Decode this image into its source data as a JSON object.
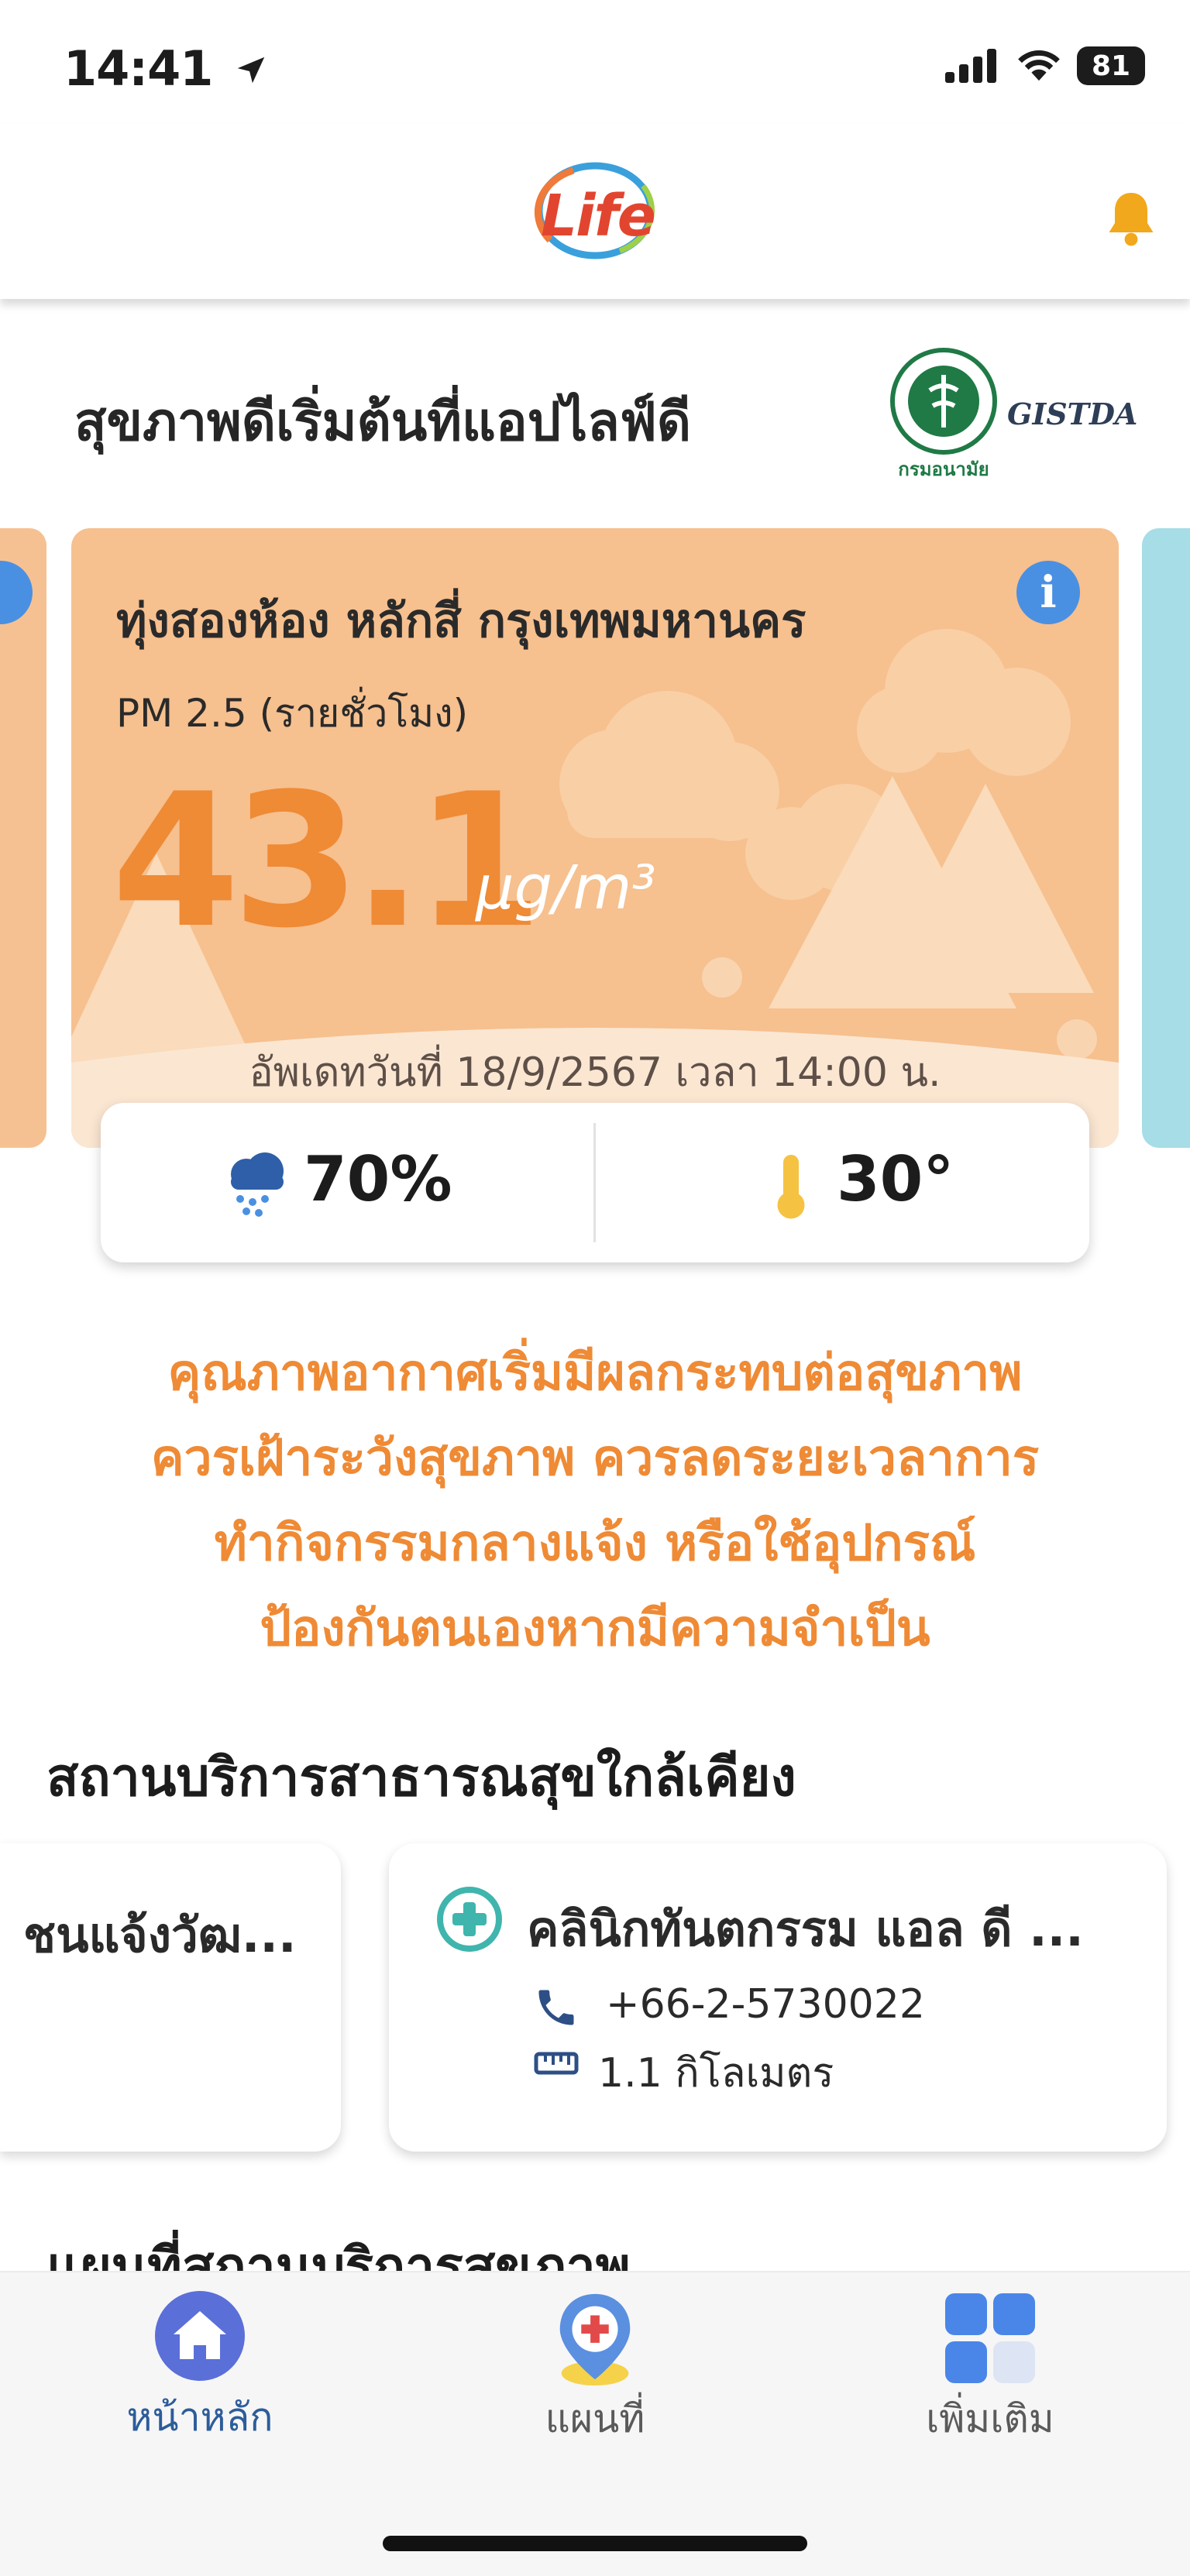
{
  "status": {
    "time": "14:41",
    "battery": "81"
  },
  "header": {
    "logo_text": "Life"
  },
  "intro": {
    "title": "สุขภาพดีเริ่มต้นที่แอปไลฟ์ดี",
    "partner_logo": "GISTDA",
    "moph_caption": "กรมอนามัย"
  },
  "air_card": {
    "location": "ทุ่งสองห้อง หลักสี่ กรุงเทพมหานคร",
    "pm_label": "PM 2.5 (รายชั่วโมง)",
    "value": "43.1",
    "unit": "μg/m³",
    "updated": "อัพเดทวันที่ 18/9/2567 เวลา 14:00 น.",
    "info_icon": "info-icon",
    "card_color": "#f6c08f",
    "value_color": "#ef8a35"
  },
  "weather": {
    "humidity": "70%",
    "temperature": "30°"
  },
  "advice": {
    "lines": [
      "คุณภาพอากาศเริ่มมีผลกระทบต่อสุขภาพ",
      "ควรเฝ้าระวังสุขภาพ ควรลดระยะเวลาการ",
      "ทำกิจกรรมกลางแจ้ง หรือใช้อุปกรณ์",
      "ป้องกันตนเองหากมีความจำเป็น"
    ]
  },
  "facilities": {
    "title": "สถานบริการสาธารณสุขใกล้เคียง",
    "cards": [
      {
        "name": "ชนแจ้งวัฒ..."
      },
      {
        "name": "คลินิกทันตกรรม แอล ดี ...",
        "phone": "+66-2-5730022",
        "distance": "1.1 กิโลเมตร"
      }
    ]
  },
  "map_section": {
    "title": "แผนที่สถานบริการสุขภาพ"
  },
  "nav": {
    "items": [
      {
        "label": "หน้าหลัก",
        "icon": "home-icon",
        "active": true
      },
      {
        "label": "แผนที่",
        "icon": "map-pin-icon",
        "active": false
      },
      {
        "label": "เพิ่มเติม",
        "icon": "grid-icon",
        "active": false
      }
    ],
    "active_color": "#2d5c9a"
  }
}
